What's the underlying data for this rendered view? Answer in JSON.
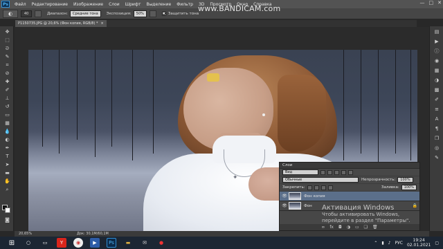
{
  "menubar": {
    "logo": "Ps",
    "items": [
      "Файл",
      "Редактирование",
      "Изображение",
      "Слои",
      "Шрифт",
      "Выделение",
      "Фильтр",
      "3D",
      "Просмотр",
      "Окно",
      "Справка"
    ],
    "window_controls": [
      "—",
      "□",
      "✕"
    ]
  },
  "optbar": {
    "brush_size": "40",
    "range_label": "Диапазон:",
    "range_value": "Средние тона",
    "exposure_label": "Экспозиция:",
    "exposure_value": "50%",
    "protect_tones_label": "Защитить тона"
  },
  "watermark": {
    "text": "www.BANDICAM.com"
  },
  "document": {
    "tab_title": "P1150735.JPG @ 20,6% (Фон копия, RGB/8) *",
    "close": "×"
  },
  "layers_panel": {
    "title": "Слои",
    "filter_value": "Вид",
    "blend_mode": "Обычные",
    "opacity_label": "Непрозрачность:",
    "opacity_value": "100%",
    "lock_label": "Закрепить:",
    "fill_label": "Заливка:",
    "fill_value": "100%",
    "layers": [
      {
        "name": "Фон копия",
        "visible": true,
        "active": true
      },
      {
        "name": "Фон",
        "visible": true,
        "active": false,
        "locked": true
      }
    ]
  },
  "activation": {
    "title": "Активация Windows",
    "line1": "Чтобы активировать Windows,",
    "line2": "перейдите в раздел \"Параметры\"."
  },
  "statusbar": {
    "zoom": "20,65%",
    "doc_info": "Док: 30,1M/60,1M"
  },
  "taskbar": {
    "language": "РУС",
    "time": "19:24",
    "date": "02.01.2021"
  },
  "colors": {
    "menubar_bg": "#535353",
    "panel_bg": "#474747",
    "active_layer": "#5b6f8a",
    "taskbar_bg": "#1c2633"
  }
}
